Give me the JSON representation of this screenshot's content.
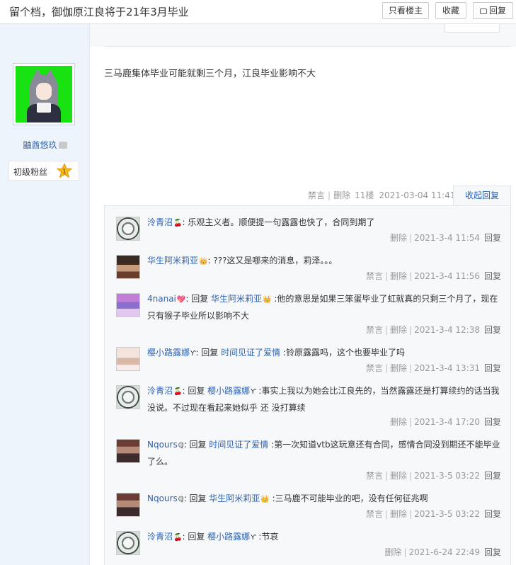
{
  "header": {
    "title": "留个档，御伽原江良将于21年3月毕业",
    "btn_host_only": "只看楼主",
    "btn_favorite": "收藏",
    "btn_reply": "回复"
  },
  "user": {
    "name": "鼬酋悠玖",
    "level": "初级粉丝",
    "level_num": "1"
  },
  "post": {
    "text": "三马鹿集体毕业可能就剩三个月，江良毕业影响不大",
    "ban": "禁言",
    "delete": "删除",
    "floor": "11楼",
    "time": "2021-03-04 11:41",
    "collapse": "收起回复"
  },
  "comments": [
    {
      "name": "泠青沼",
      "emo": "🍒",
      "text": ": 乐观主义者。顺便提一句露露也快了，合同到期了",
      "actions": "删除",
      "ban": "",
      "time": "2021-3-4 11:54",
      "reply": "回复"
    },
    {
      "name": "华生阿米莉亚",
      "emo": "👑",
      "text": ": ???这又是哪来的消息，莉泽。。。",
      "actions": "删除",
      "ban": "禁言",
      "time": "2021-3-4 11:56",
      "reply": "回复"
    },
    {
      "name": "4nanai",
      "emo": "💖",
      "reply_to_prefix": ": 回复 ",
      "reply_to": "华生阿米莉亚",
      "reply_to_emo": "👑",
      "text": " :他的意思是如果三笨蛋毕业了虹就真的只剩三个月了，现在只有猴子毕业所以影响不大",
      "actions": "删除",
      "ban": "禁言",
      "time": "2021-3-4 12:38",
      "reply": "回复"
    },
    {
      "name": "樱小路露娜",
      "emo": "Ƴ",
      "reply_to_prefix": ": 回复 ",
      "reply_to": "时间见证了爱情",
      "text": " :铃原露露吗，这个也要毕业了吗",
      "actions": "删除",
      "ban": "禁言",
      "time": "2021-3-4 13:31",
      "reply": "回复"
    },
    {
      "name": "泠青沼",
      "emo": "🍒",
      "reply_to_prefix": ": 回复 ",
      "reply_to": "樱小路露娜",
      "reply_to_emo": "Ƴ",
      "text": " :事实上我以为她会比江良先的，当然露露还是打算续约的话当我没说。不过现在看起来她似乎 还 没打算续",
      "actions": "删除",
      "ban": "",
      "time": "2021-3-4 17:20",
      "reply": "回复"
    },
    {
      "name": "Nqours",
      "emo": "ℚ",
      "reply_to_prefix": ": 回复 ",
      "reply_to": "时间见证了爱情",
      "text": " :第一次知道vtb这玩意还有合同，感情合同没到期还不能毕业了么。",
      "actions": "删除",
      "ban": "禁言",
      "time": "2021-3-5 03:22",
      "reply": "回复"
    },
    {
      "name": "Nqours",
      "emo": "ℚ",
      "reply_to_prefix": ": 回复 ",
      "reply_to": "华生阿米莉亚",
      "reply_to_emo": "👑",
      "text": " :三马鹿不可能毕业的吧，没有任何征兆啊",
      "actions": "删除",
      "ban": "禁言",
      "time": "2021-3-5 03:22",
      "reply": "回复"
    },
    {
      "name": "泠青沼",
      "emo": "🍒",
      "reply_to_prefix": ": 回复 ",
      "reply_to": "樱小路露娜",
      "reply_to_emo": "Ƴ",
      "text": " :节哀",
      "actions": "删除",
      "ban": "",
      "time": "2021-6-24 22:49",
      "reply": "回复"
    }
  ]
}
